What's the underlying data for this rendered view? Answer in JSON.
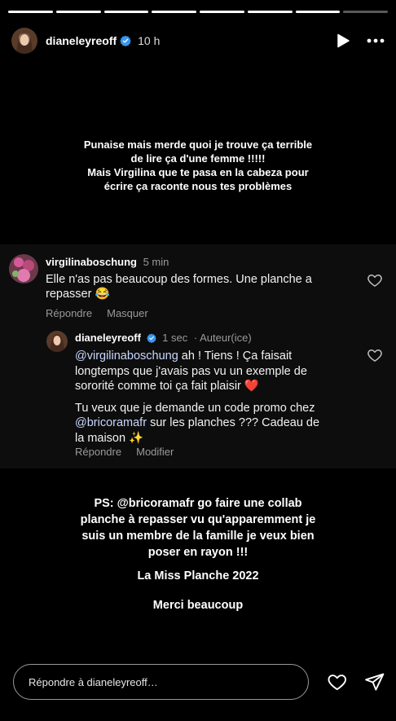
{
  "progress": {
    "segments_total": 8,
    "segments_done": 7
  },
  "header": {
    "username": "dianeleyreoff",
    "time": "10 h",
    "icons": [
      "verified-icon",
      "play-icon",
      "more-icon"
    ]
  },
  "captions": {
    "top": [
      "Punaise mais merde quoi je trouve ça terrible",
      "de lire ça d'une femme !!!!!",
      "Mais Virgilina que te pasa en la cabeza pour",
      "écrire ça raconte nous tes problèmes"
    ],
    "bottom_lines": [
      "PS: @bricoramafr go faire une collab",
      "planche à repasser vu qu'apparemment je",
      "suis un membre de la famille je veux bien",
      "poser en rayon !!!"
    ],
    "signature": "La Miss Planche 2022",
    "thanks": "Merci beaucoup"
  },
  "comment": {
    "username": "virgilinaboschung",
    "time": "5 min",
    "text_line1": "Elle n'as pas beaucoup des formes.  Une planche a",
    "text_line2": "repasser 😂",
    "reply_label": "Répondre",
    "hide_label": "Masquer"
  },
  "reply": {
    "username": "dianeleyreoff",
    "time": "1 sec",
    "author_label": "Auteur(ice)",
    "mention": "@virgilinaboschung",
    "line1_rest": " ah ! Tiens ! Ça faisait",
    "line2": "longtemps que j'avais pas vu un exemple de",
    "line3": "sororité comme toi ça fait plaisir ❤️",
    "line4": "Tu veux que je demande un code promo chez",
    "mention2": "@bricoramafr",
    "line5_rest": " sur les planches ??? Cadeau de",
    "line6": "la maison ✨",
    "reply_label": "Répondre",
    "edit_label": "Modifier"
  },
  "footer": {
    "placeholder": "Répondre à dianeleyreoff…",
    "icons": [
      "heart-icon",
      "send-icon"
    ]
  },
  "colors": {
    "background": "#000000",
    "comment_card": "#0d0d0d",
    "verified": "#3897f0",
    "mention": "#c9d7ff"
  }
}
